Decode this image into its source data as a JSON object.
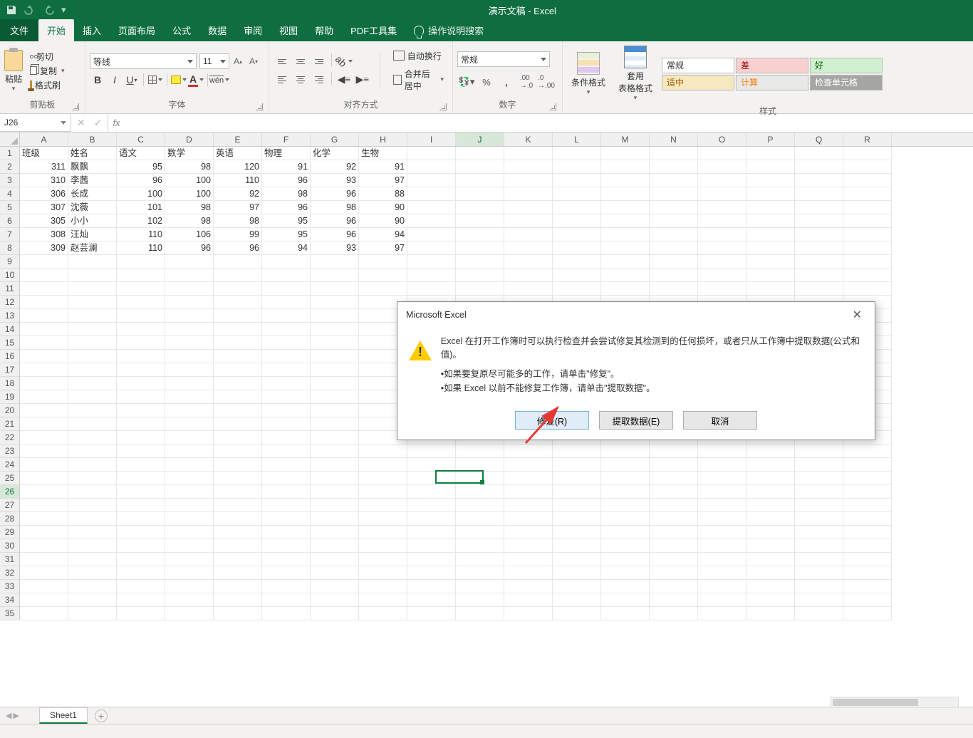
{
  "app_title": "演示文稿 - Excel",
  "tabs": {
    "file": "文件",
    "home": "开始",
    "insert": "插入",
    "layout": "页面布局",
    "formulas": "公式",
    "data": "数据",
    "review": "审阅",
    "view": "视图",
    "help": "帮助",
    "pdf": "PDF工具集",
    "tellme": "操作说明搜索"
  },
  "ribbon": {
    "clipboard": {
      "paste": "粘贴",
      "cut": "剪切",
      "copy": "复制",
      "painter": "格式刷",
      "label": "剪贴板"
    },
    "font": {
      "name": "等线",
      "size": "11",
      "label": "字体"
    },
    "align": {
      "wrap": "自动换行",
      "merge": "合并后居中",
      "label": "对齐方式"
    },
    "number": {
      "format": "常规",
      "label": "数字"
    },
    "styles": {
      "cf": "条件格式",
      "ts": "套用\n表格格式",
      "normal": "常规",
      "bad": "差",
      "good": "好",
      "neutral": "适中",
      "calc": "计算",
      "check": "检查单元格",
      "label": "样式"
    }
  },
  "namebox": "J26",
  "columns": [
    "A",
    "B",
    "C",
    "D",
    "E",
    "F",
    "G",
    "H",
    "I",
    "J",
    "K",
    "L",
    "M",
    "N",
    "O",
    "P",
    "Q",
    "R"
  ],
  "row_count": 35,
  "headers": [
    "班级",
    "姓名",
    "语文",
    "数学",
    "英语",
    "物理",
    "化学",
    "生物"
  ],
  "data_rows": [
    [
      "311",
      "飘飘",
      "95",
      "98",
      "120",
      "91",
      "92",
      "91"
    ],
    [
      "310",
      "李茜",
      "96",
      "100",
      "110",
      "96",
      "93",
      "97"
    ],
    [
      "306",
      "长成",
      "100",
      "100",
      "92",
      "98",
      "96",
      "88"
    ],
    [
      "307",
      "沈薇",
      "101",
      "98",
      "97",
      "96",
      "98",
      "90"
    ],
    [
      "305",
      "小小",
      "102",
      "98",
      "98",
      "95",
      "96",
      "90"
    ],
    [
      "308",
      "汪灿",
      "110",
      "106",
      "99",
      "95",
      "96",
      "94"
    ],
    [
      "309",
      "赵芸澜",
      "110",
      "96",
      "96",
      "94",
      "93",
      "97"
    ]
  ],
  "active": {
    "col_index": 9,
    "row": 26
  },
  "sheet": {
    "name": "Sheet1"
  },
  "dialog": {
    "title": "Microsoft Excel",
    "msg1": "Excel 在打开工作簿时可以执行检查并会尝试修复其检测到的任何损坏，或者只从工作簿中提取数据(公式和值)。",
    "msg2": "•如果要复原尽可能多的工作，请单击\"修复\"。",
    "msg3": "•如果 Excel 以前不能修复工作簿，请单击\"提取数据\"。",
    "repair": "修复(R)",
    "extract": "提取数据(E)",
    "cancel": "取消"
  }
}
